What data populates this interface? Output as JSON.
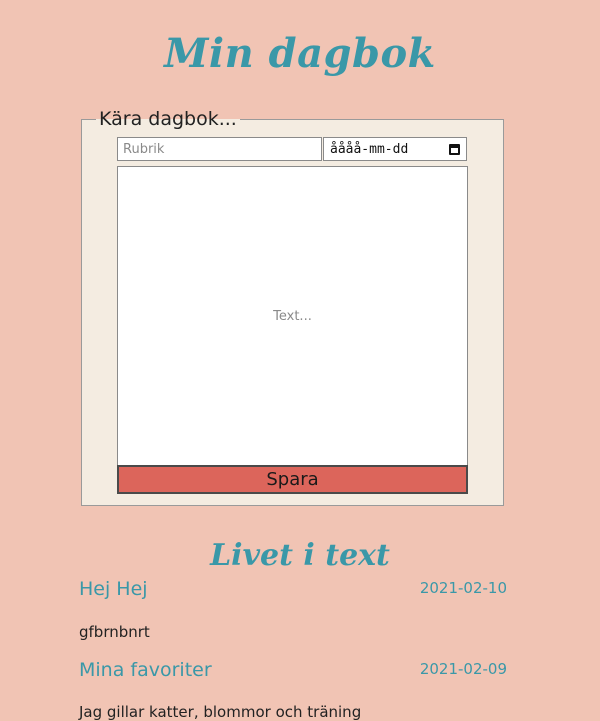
{
  "header": {
    "title": "Min dagbok"
  },
  "form": {
    "legend": "Kära dagbok...",
    "title_placeholder": "Rubrik",
    "date_placeholder": "åååå-mm-dd",
    "text_placeholder": "Text...",
    "save_label": "Spara"
  },
  "entries_section": {
    "title": "Livet i text"
  },
  "entries": [
    {
      "title": "Hej Hej",
      "date": "2021-02-10",
      "body": "gfbrnbnrt"
    },
    {
      "title": "Mina favoriter",
      "date": "2021-02-09",
      "body": "Jag gillar katter, blommor och träning"
    }
  ],
  "colors": {
    "background": "#f1c4b4",
    "accent": "#3a98a8",
    "form_background": "#f4ece1",
    "button": "#dc655b"
  }
}
